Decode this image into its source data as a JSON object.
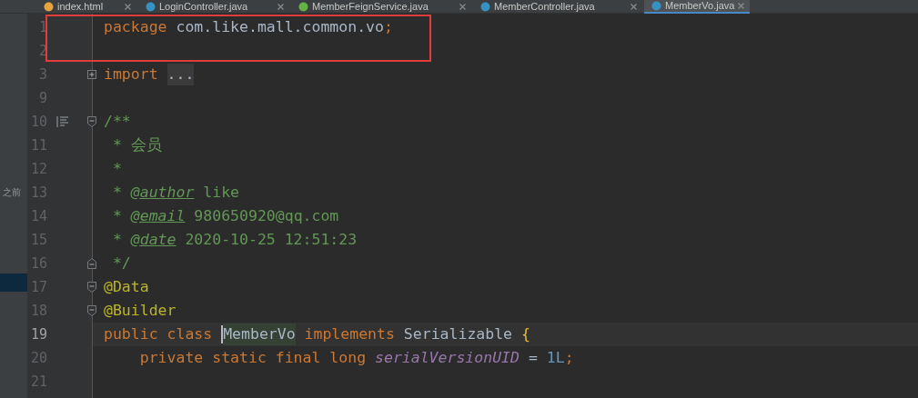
{
  "tabs": [
    {
      "label": "index.html",
      "kind": "html",
      "selected": false
    },
    {
      "label": "LoginController.java",
      "kind": "class",
      "selected": false
    },
    {
      "label": "MemberFeignService.java",
      "kind": "interface",
      "selected": false
    },
    {
      "label": "MemberController.java",
      "kind": "class",
      "selected": false
    },
    {
      "label": "MemberVo.java",
      "kind": "class",
      "selected": true
    }
  ],
  "side_panel": {
    "label": "之前"
  },
  "editor": {
    "rows": [
      {
        "number": "1",
        "boxed": true,
        "tokens": [
          {
            "kind": "keyword",
            "text": "package"
          },
          {
            "kind": "plain",
            "text": " com.like.mall.common.vo"
          },
          {
            "kind": "keyword",
            "text": ";"
          }
        ]
      },
      {
        "number": "2",
        "boxed": true,
        "tokens": []
      },
      {
        "number": "3",
        "fold_start": true,
        "collapsed": true,
        "tokens": [
          {
            "kind": "keyword",
            "text": "import "
          },
          {
            "kind": "folded",
            "text": "..."
          }
        ]
      },
      {
        "number": "9",
        "tokens": []
      },
      {
        "number": "10",
        "fold_start": true,
        "collapsed": false,
        "doc_toggle": true,
        "tokens": [
          {
            "kind": "doc",
            "text": "/**"
          }
        ]
      },
      {
        "number": "11",
        "tokens": [
          {
            "kind": "doc",
            "text": " * 会员"
          }
        ]
      },
      {
        "number": "12",
        "tokens": [
          {
            "kind": "doc",
            "text": " *"
          }
        ]
      },
      {
        "number": "13",
        "tokens": [
          {
            "kind": "doc",
            "text": " * "
          },
          {
            "kind": "doc_tag",
            "text": "@author"
          },
          {
            "kind": "doc",
            "text": " like"
          }
        ]
      },
      {
        "number": "14",
        "tokens": [
          {
            "kind": "doc",
            "text": " * "
          },
          {
            "kind": "doc_tag",
            "text": "@email"
          },
          {
            "kind": "doc",
            "text": " 980650920@qq.com"
          }
        ]
      },
      {
        "number": "15",
        "tokens": [
          {
            "kind": "doc",
            "text": " * "
          },
          {
            "kind": "doc_tag",
            "text": "@date"
          },
          {
            "kind": "doc",
            "text": " 2020-10-25 12:51:23"
          }
        ]
      },
      {
        "number": "16",
        "fold_end": true,
        "tokens": [
          {
            "kind": "doc",
            "text": " */"
          }
        ]
      },
      {
        "number": "17",
        "fold_start": true,
        "collapsed": false,
        "tokens": [
          {
            "kind": "annotation",
            "text": "@Data"
          }
        ]
      },
      {
        "number": "18",
        "fold_start": true,
        "collapsed": false,
        "tokens": [
          {
            "kind": "annotation",
            "text": "@Builder"
          }
        ]
      },
      {
        "number": "19",
        "current": true,
        "tokens": [
          {
            "kind": "keyword",
            "text": "public class "
          },
          {
            "kind": "usage",
            "text": "MemberVo",
            "caret": true
          },
          {
            "kind": "keyword",
            "text": " implements"
          },
          {
            "kind": "plain",
            "text": " Serializable "
          },
          {
            "kind": "brace",
            "text": "{"
          }
        ]
      },
      {
        "number": "20",
        "tokens": [
          {
            "kind": "keyword",
            "text": "    private static final long "
          },
          {
            "kind": "static_field",
            "text": "serialVersionUID"
          },
          {
            "kind": "plain",
            "text": " = "
          },
          {
            "kind": "number",
            "text": "1L"
          },
          {
            "kind": "keyword",
            "text": ";"
          }
        ]
      },
      {
        "number": "21",
        "tokens": []
      }
    ]
  }
}
